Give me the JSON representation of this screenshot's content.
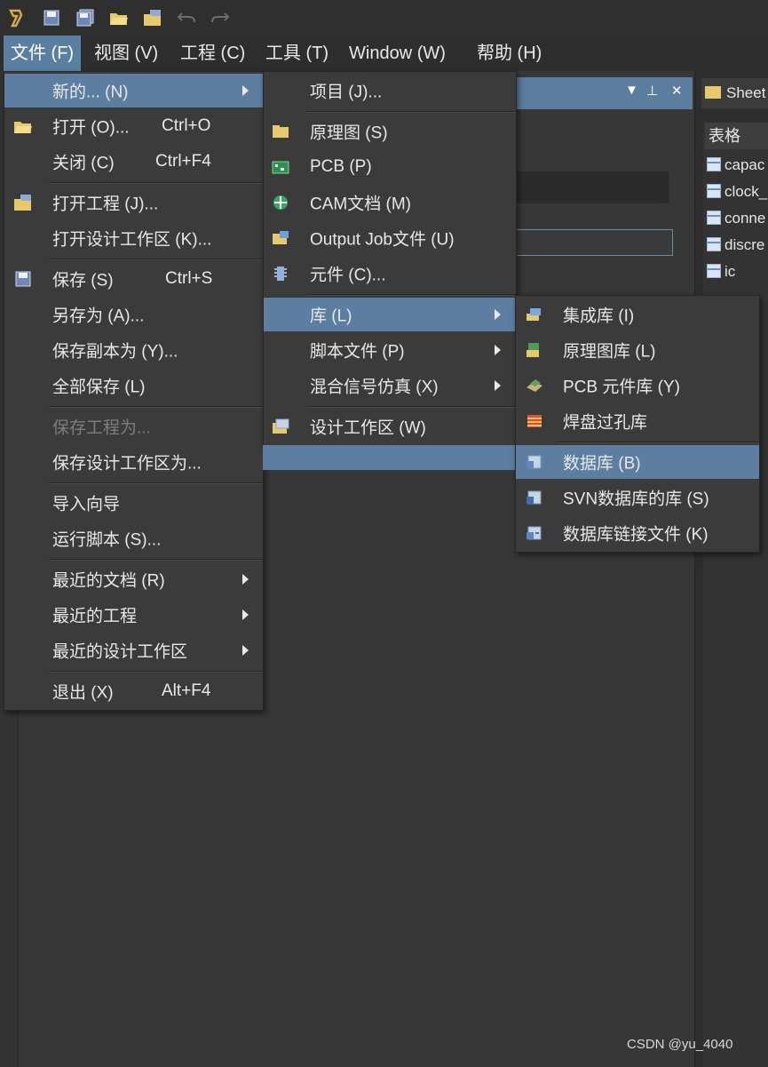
{
  "menubar": {
    "items": [
      {
        "label": "文件 (F)",
        "name": "menu-file",
        "active": true
      },
      {
        "label": "视图 (V)",
        "name": "menu-view"
      },
      {
        "label": "工程 (C)",
        "name": "menu-project"
      },
      {
        "label": "工具 (T)",
        "name": "menu-tools"
      },
      {
        "label": "Window (W)",
        "name": "menu-window"
      },
      {
        "label": "帮助 (H)",
        "name": "menu-help"
      }
    ]
  },
  "file_menu": {
    "items": [
      {
        "label": "新的... (N)",
        "submenu": true,
        "highlighted": true
      },
      {
        "label": "打开 (O)...",
        "shortcut": "Ctrl+O",
        "icon": "open-folder-icon"
      },
      {
        "label": "关闭 (C)",
        "shortcut": "Ctrl+F4"
      },
      {
        "label": "打开工程 (J)...",
        "icon": "open-project-icon"
      },
      {
        "label": "打开设计工作区 (K)..."
      },
      {
        "label": "保存 (S)",
        "shortcut": "Ctrl+S",
        "icon": "save-icon"
      },
      {
        "label": "另存为 (A)..."
      },
      {
        "label": "保存副本为 (Y)..."
      },
      {
        "label": "全部保存 (L)"
      },
      {
        "label": "保存工程为...",
        "disabled": true
      },
      {
        "label": "保存设计工作区为..."
      },
      {
        "label": "导入向导"
      },
      {
        "label": "运行脚本 (S)..."
      },
      {
        "label": "最近的文档 (R)",
        "submenu": true
      },
      {
        "label": "最近的工程",
        "submenu": true
      },
      {
        "label": "最近的设计工作区",
        "submenu": true
      },
      {
        "label": "退出 (X)",
        "shortcut": "Alt+F4"
      }
    ]
  },
  "new_menu": {
    "items": [
      {
        "label": "项目 (J)..."
      },
      {
        "label": "原理图 (S)",
        "icon": "schematic-icon"
      },
      {
        "label": "PCB (P)",
        "icon": "pcb-icon"
      },
      {
        "label": "CAM文档 (M)",
        "icon": "cam-icon"
      },
      {
        "label": "Output Job文件 (U)",
        "icon": "output-job-icon"
      },
      {
        "label": "元件 (C)...",
        "icon": "component-icon"
      },
      {
        "label": "库 (L)",
        "submenu": true,
        "highlighted": true
      },
      {
        "label": "脚本文件 (P)",
        "submenu": true
      },
      {
        "label": "混合信号仿真 (X)",
        "submenu": true
      },
      {
        "label": "设计工作区 (W)",
        "icon": "workspace-icon"
      }
    ]
  },
  "library_menu": {
    "items": [
      {
        "label": "集成库 (I)",
        "icon": "integrated-library-icon"
      },
      {
        "label": "原理图库 (L)",
        "icon": "schematic-library-icon"
      },
      {
        "label": "PCB 元件库 (Y)",
        "icon": "pcb-library-icon"
      },
      {
        "label": "焊盘过孔库",
        "icon": "pad-via-library-icon"
      },
      {
        "label": "数据库 (B)",
        "icon": "database-icon",
        "highlighted": true
      },
      {
        "label": "SVN数据库的库 (S)",
        "icon": "svn-database-icon"
      },
      {
        "label": "数据库链接文件 (K)",
        "icon": "database-link-icon"
      }
    ]
  },
  "right_panel": {
    "tab": "Sheet",
    "header": "表格",
    "items": [
      "capac",
      "clock_",
      "conne",
      "discre",
      "ic"
    ]
  },
  "watermark": "CSDN @yu_4040"
}
